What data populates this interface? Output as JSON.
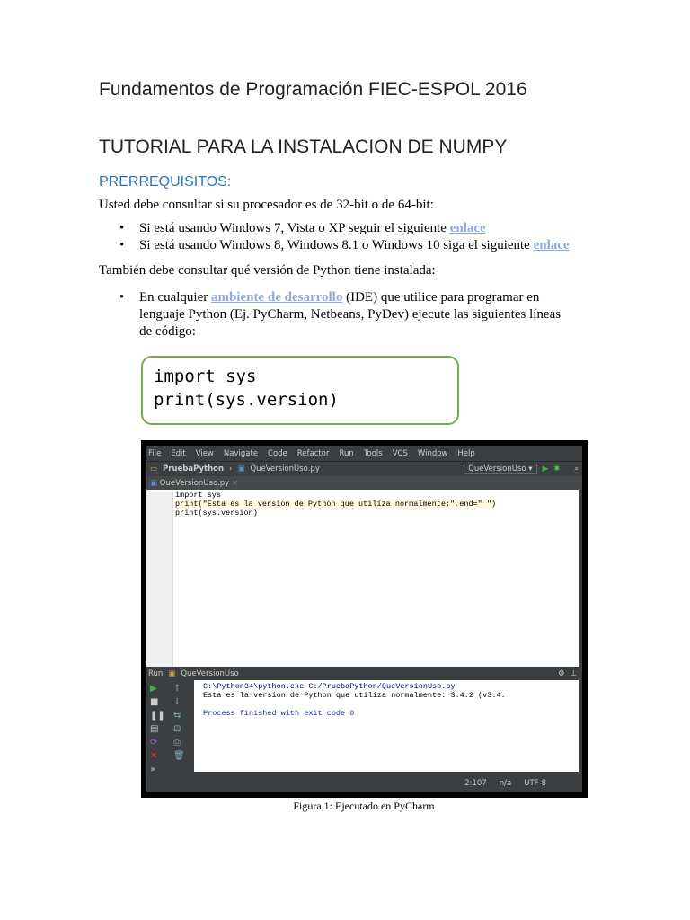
{
  "header": {
    "course_title": "Fundamentos de Programación FIEC-ESPOL 2016",
    "tutorial_title": "TUTORIAL PARA LA INSTALACION DE NUMPY",
    "section": "PRERREQUISITOS:"
  },
  "body": {
    "p1": "Usted debe consultar si su procesador es de 32-bit o de 64-bit:",
    "bullets1": [
      {
        "text": "Si está usando Windows 7, Vista o XP seguir el siguiente ",
        "link": "enlace"
      },
      {
        "text": "Si está usando Windows 8, Windows 8.1 o Windows 10 siga el siguiente ",
        "link": "enlace"
      }
    ],
    "p2": "También debe consultar qué versión de Python tiene instalada:",
    "bullet2": {
      "pre": "En cualquier ",
      "link": "ambiente de desarrollo",
      "line1_post": " (IDE) que utilice para programar en",
      "line2": "lenguaje Python (Ej. PyCharm, Netbeans, PyDev) ejecute las siguientes líneas",
      "line3": "de código:"
    },
    "code": [
      "import sys",
      "print(sys.version)"
    ]
  },
  "ide": {
    "menu": [
      "File",
      "Edit",
      "View",
      "Navigate",
      "Code",
      "Refactor",
      "Run",
      "Tools",
      "VCS",
      "Window",
      "Help"
    ],
    "project": "PruebaPython",
    "file": "QueVersionUso.py",
    "run_config": "QueVersionUso",
    "tab": "QueVersionUso.py",
    "editor_lines": [
      "import sys",
      "print(\"Esta es la version de Python que utiliza normalmente:\",end=\" \")",
      "print(sys.version)"
    ],
    "run_label": "Run",
    "run_name": "QueVersionUso",
    "console": [
      "C:\\Python34\\python.exe C:/PruebaPython/QueVersionUso.py",
      "Esta es la version de Python que utiliza normalmente: 3.4.2 (v3.4.",
      "",
      "Process finished with exit code 0"
    ],
    "status": {
      "position": "2:107",
      "na": "n/a",
      "encoding": "UTF-8"
    }
  },
  "caption": "Figura 1: Ejecutado en PyCharm"
}
